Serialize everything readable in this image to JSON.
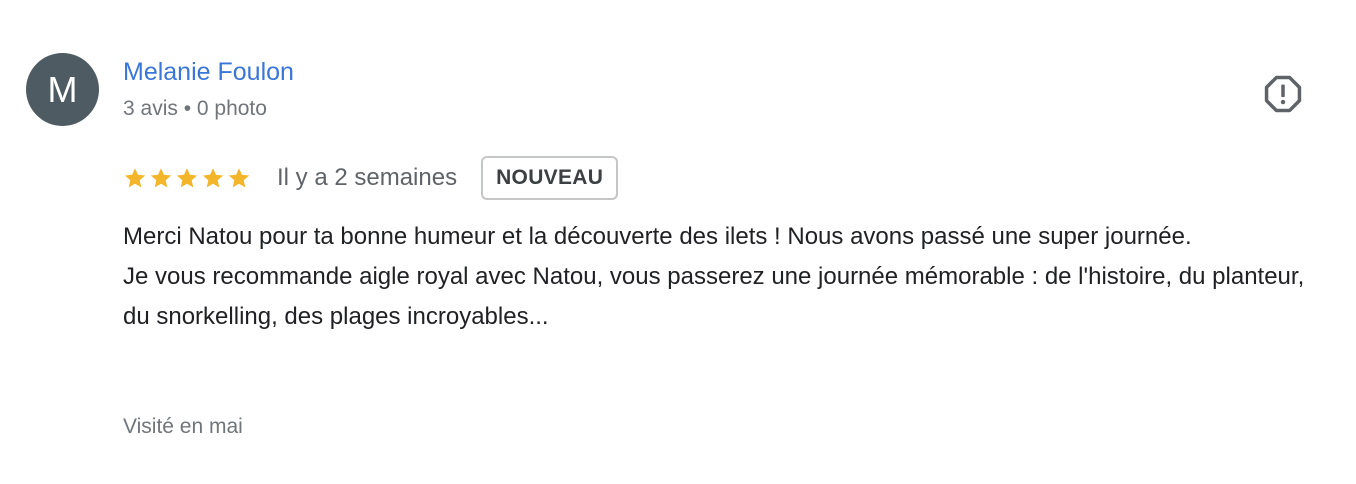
{
  "reviewer": {
    "avatar_initial": "M",
    "avatar_color": "#4f5b62",
    "name": "Melanie Foulon",
    "name_color": "#3a76d8",
    "meta": "3 avis • 0 photo"
  },
  "review": {
    "rating": 5,
    "max_rating": 5,
    "star_color": "#f3b62b",
    "date": "Il y a 2 semaines",
    "badge": "NOUVEAU",
    "paragraphs": [
      "Merci Natou pour ta bonne humeur et la découverte des ilets ! Nous avons passé une super journée.",
      "Je vous recommande aigle royal avec Natou, vous passerez une journée mémorable : de l'histoire, du planteur, du snorkelling, des plages incroyables..."
    ],
    "visit": "Visité en mai"
  },
  "actions": {
    "report_icon": "report-octagon-icon"
  }
}
